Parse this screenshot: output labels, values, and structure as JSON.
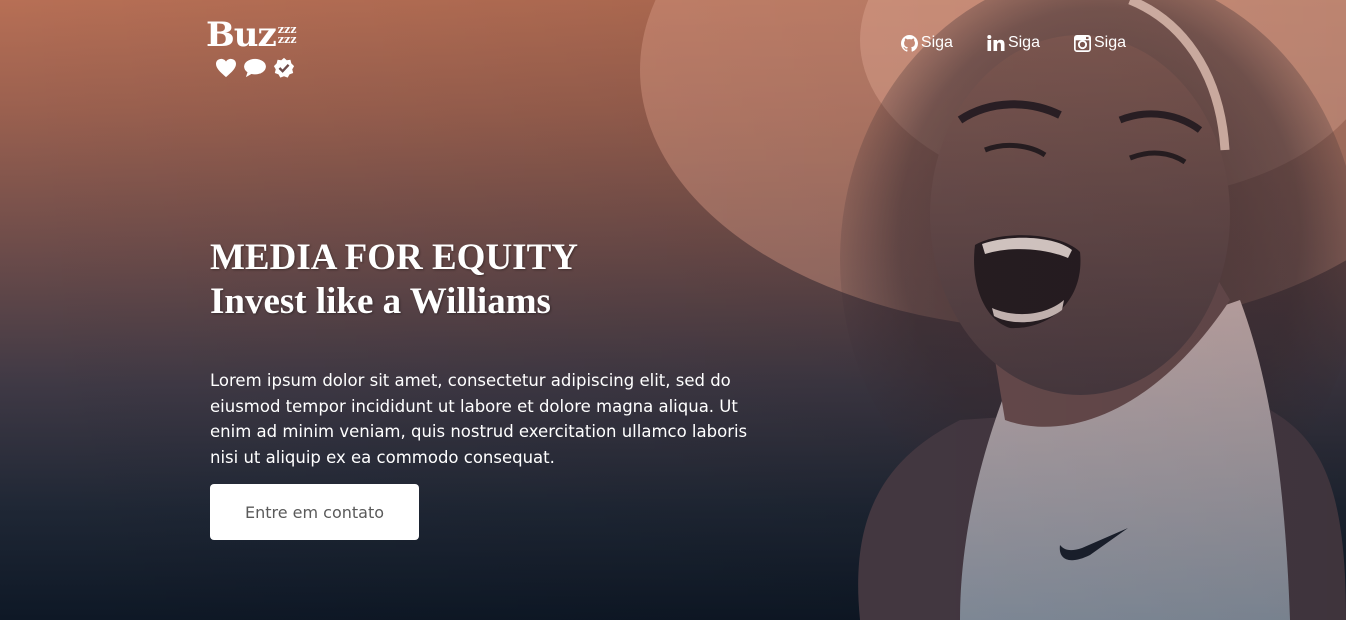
{
  "logo": {
    "word": "Buz",
    "z_lines": [
      "zzz",
      "zzz"
    ],
    "icons": [
      "heart-icon",
      "chat-bubble-icon",
      "verified-badge-icon"
    ]
  },
  "nav": {
    "items": [
      {
        "icon": "github-icon",
        "label": "Siga"
      },
      {
        "icon": "linkedin-icon",
        "label": "Siga"
      },
      {
        "icon": "instagram-icon",
        "label": "Siga"
      }
    ]
  },
  "hero": {
    "title_line1": "MEDIA FOR EQUITY",
    "title_line2": "Invest like a Williams",
    "body": "Lorem ipsum dolor sit amet, consectetur adipiscing elit, sed do eiusmod tempor incididunt ut labore et dolore magna aliqua. Ut enim ad minim veniam, quis nostrud exercitation ullamco laboris nisi ut aliquip ex ea commodo consequat.",
    "cta_label": "Entre em contato"
  },
  "colors": {
    "gradient_top": "#b76f55",
    "gradient_bottom": "#0e1826",
    "button_bg": "#ffffff",
    "button_text": "#5a5a5a"
  }
}
